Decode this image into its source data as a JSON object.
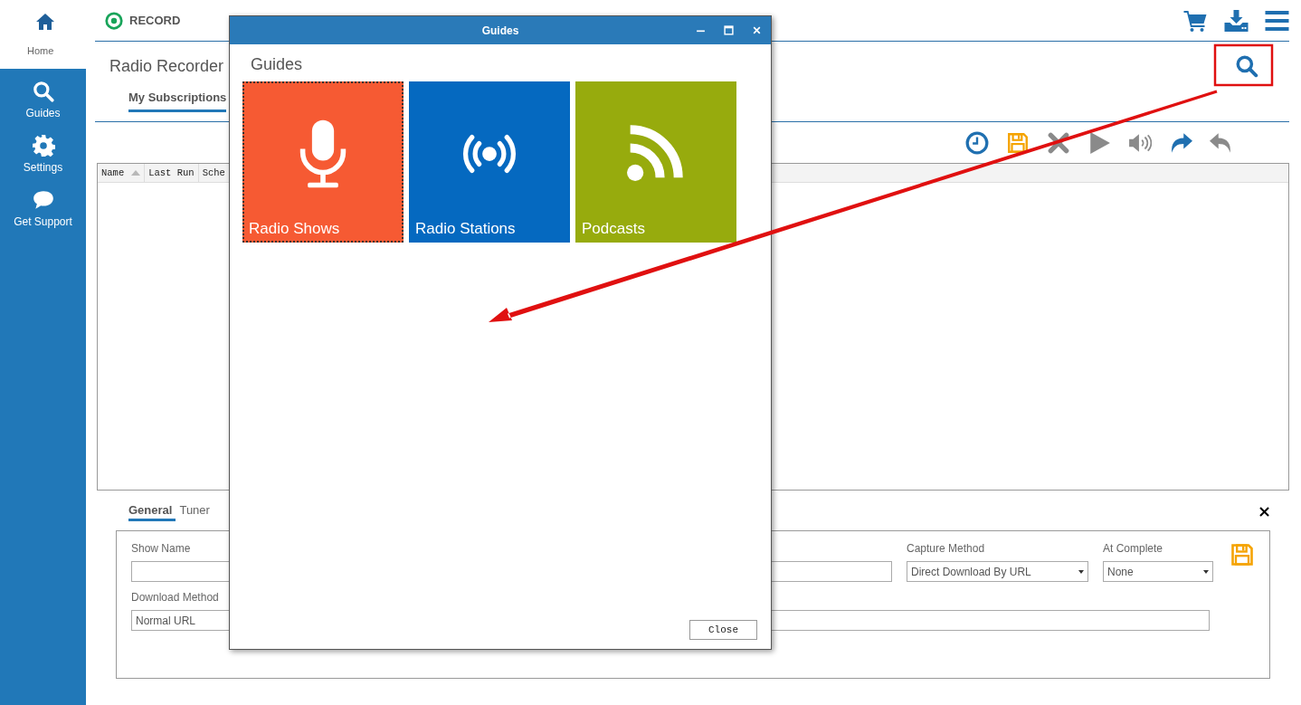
{
  "top": {
    "home_label": "Home",
    "logo_text": "RECORD"
  },
  "sidebar": [
    {
      "label": "Guides",
      "kind": "search"
    },
    {
      "label": "Settings",
      "kind": "gear"
    },
    {
      "label": "Get Support",
      "kind": "chat"
    }
  ],
  "page": {
    "title": "Radio Recorder",
    "tabs": [
      {
        "label": "My Subscriptions",
        "selected": true
      }
    ]
  },
  "toolbar": [
    {
      "kind": "clock",
      "disabled": false
    },
    {
      "kind": "save",
      "disabled": false
    },
    {
      "kind": "delete",
      "disabled": true
    },
    {
      "kind": "play",
      "disabled": true
    },
    {
      "kind": "volume",
      "disabled": true
    },
    {
      "kind": "redo",
      "disabled": false
    },
    {
      "kind": "undo",
      "disabled": true
    }
  ],
  "table": {
    "columns": [
      {
        "label": "Name",
        "sorted": true
      },
      {
        "label": "Last Run",
        "sorted": false
      },
      {
        "label": "Sche",
        "sorted": false
      }
    ]
  },
  "detail": {
    "tabs": [
      {
        "label": "General",
        "selected": true
      },
      {
        "label": "Tuner",
        "selected": false
      }
    ],
    "close": "×",
    "show_name": {
      "label": "Show Name"
    },
    "capture_method": {
      "label": "Capture Method",
      "value": "Direct Download By URL"
    },
    "at_complete": {
      "label": "At Complete",
      "value": "None"
    },
    "download_method": {
      "label": "Download Method",
      "value": "Normal URL"
    }
  },
  "dialog": {
    "title": "Guides",
    "heading": "Guides",
    "tiles": [
      {
        "label": "Radio Shows",
        "kind": "microphone",
        "color": "#f65a33",
        "selected": true
      },
      {
        "label": "Radio Stations",
        "kind": "broadcast",
        "color": "#0569c0",
        "selected": false
      },
      {
        "label": "Podcasts",
        "kind": "rss",
        "color": "#97ab0d",
        "selected": false
      }
    ],
    "close_button": "Close"
  }
}
